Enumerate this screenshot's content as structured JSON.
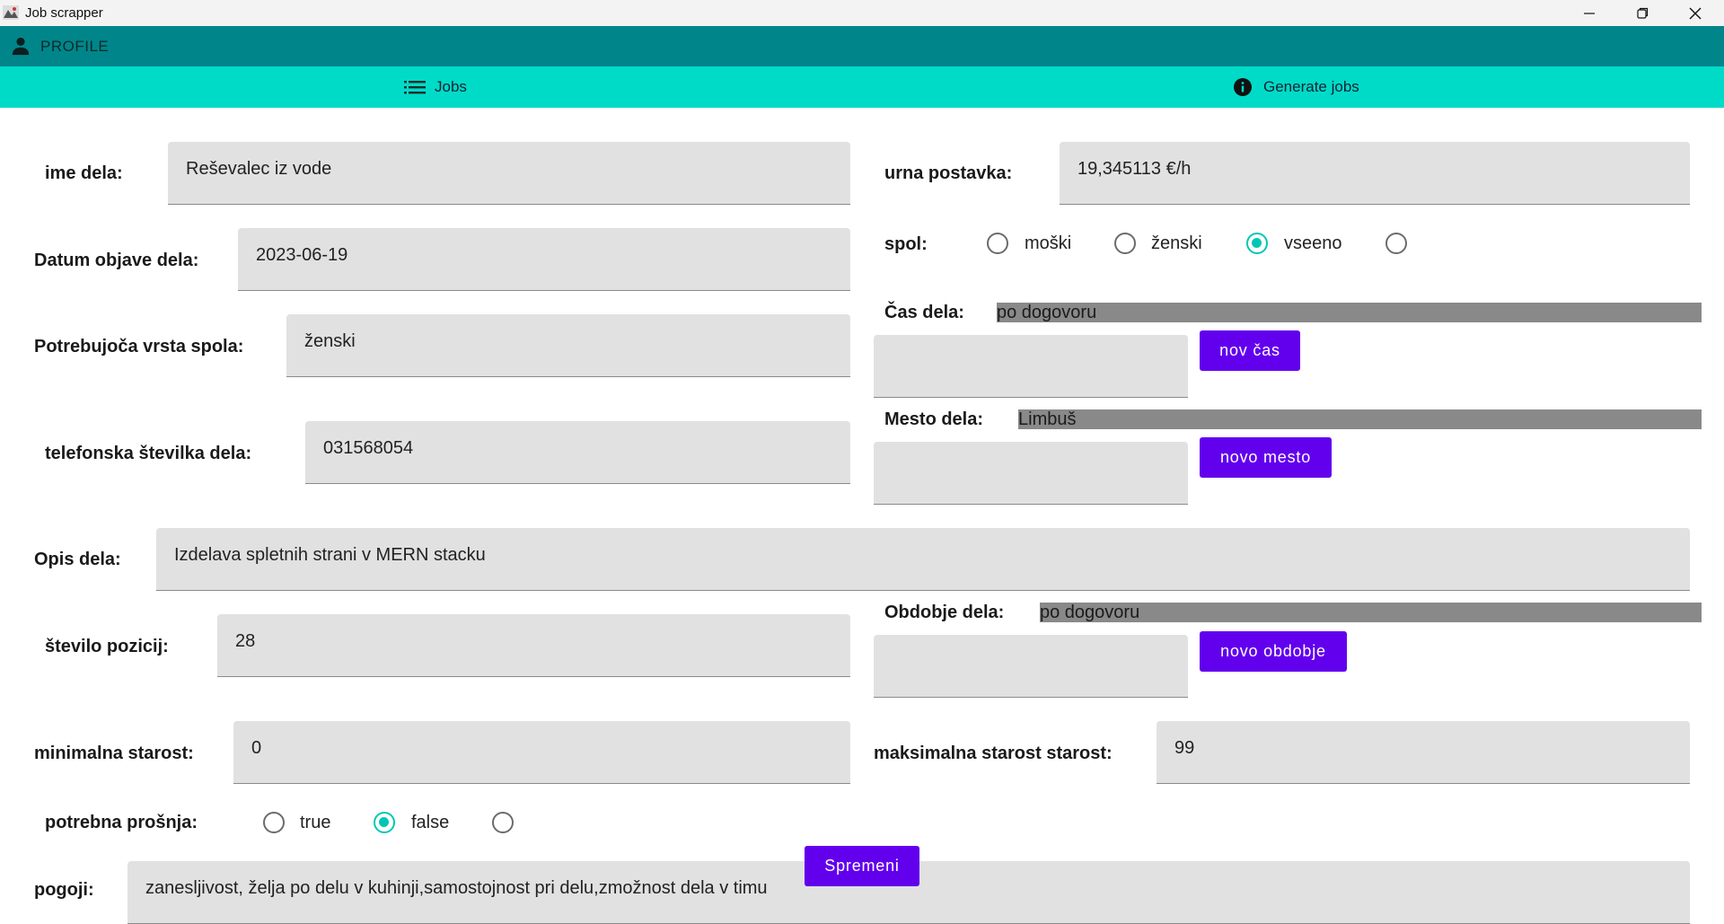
{
  "window": {
    "title": "Job scrapper"
  },
  "profile": {
    "label": "PROFILE"
  },
  "tabs": [
    {
      "label": "Jobs",
      "icon": "list-icon"
    },
    {
      "label": "Generate jobs",
      "icon": "info-icon"
    }
  ],
  "form": {
    "ime_dela": {
      "label": "ime dela:",
      "value": "Reševalec iz vode"
    },
    "datum": {
      "label": "Datum objave dela:",
      "value": "2023-06-19"
    },
    "spol_vrsta": {
      "label": "Potrebujoča vrsta spola:",
      "value": "ženski"
    },
    "telefon": {
      "label": "telefonska številka dela:",
      "value": "031568054"
    },
    "opis": {
      "label": "Opis dela:",
      "value": "Izdelava spletnih strani v MERN stacku"
    },
    "pozicije": {
      "label": "število pozicij:",
      "value": "28"
    },
    "min_starost": {
      "label": "minimalna starost:",
      "value": "0"
    },
    "max_starost": {
      "label": "maksimalna starost starost:",
      "value": "99"
    },
    "prosnja": {
      "label": "potrebna prošnja:",
      "options": [
        "true",
        "false",
        ""
      ],
      "selected": "false"
    },
    "pogoji": {
      "label": "pogoji:",
      "value": "zanesljivost, želja po delu v kuhinji,samostojnost pri delu,zmožnost dela v timu"
    },
    "urna": {
      "label": "urna postavka:",
      "value": "19,345113 €/h"
    },
    "spol": {
      "label": "spol:",
      "options": [
        "moški",
        "ženski",
        "vseeno",
        ""
      ],
      "selected": "vseeno"
    },
    "cas": {
      "label": "Čas dela:",
      "value": "po dogovoru",
      "input_value": "",
      "button": "nov čas"
    },
    "mesto": {
      "label": "Mesto dela:",
      "value": "Limbuš",
      "input_value": "",
      "button": "novo mesto"
    },
    "obdobje": {
      "label": "Obdobje dela:",
      "value": "po dogovoru",
      "input_value": "",
      "button": "novo obdobje"
    },
    "submit": "Spremeni"
  },
  "colors": {
    "profile_bar": "#00868a",
    "tab_bar": "#00dbc8",
    "button": "#6200ee",
    "radio_selected": "#00c7b4"
  }
}
